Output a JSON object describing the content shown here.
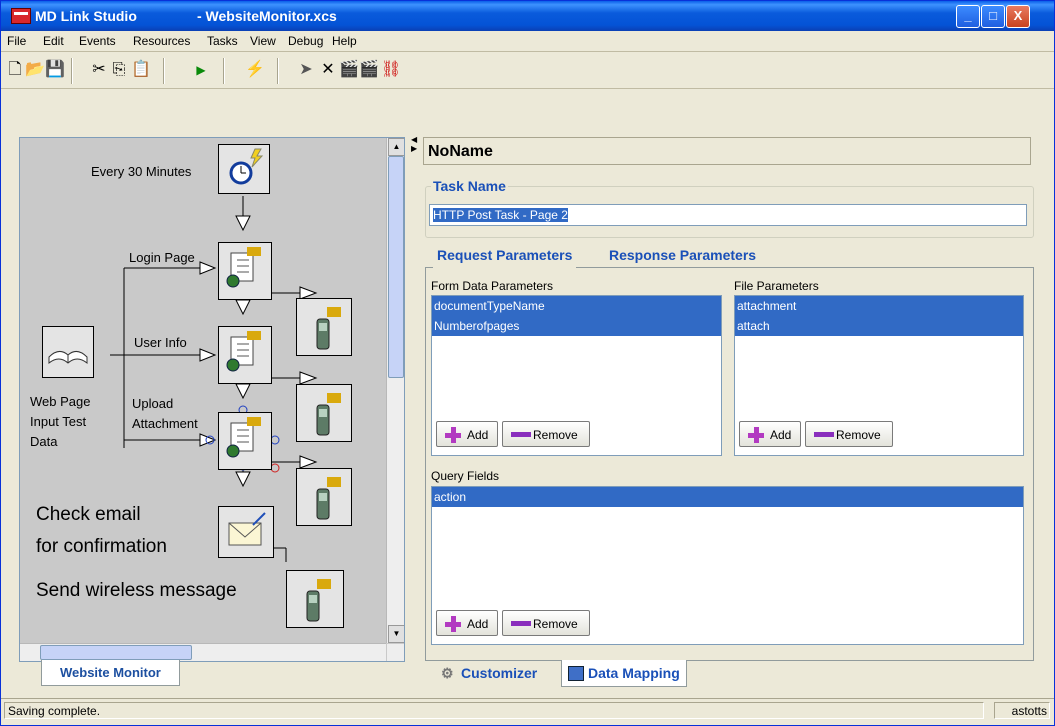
{
  "window": {
    "app_name": "MD Link Studio",
    "doc_title": "- WebsiteMonitor.xcs",
    "minimize": "_",
    "maximize": "□",
    "close": "X"
  },
  "menu": [
    "File",
    "Edit",
    "Events",
    "Resources",
    "Tasks",
    "View",
    "Debug",
    "Help"
  ],
  "toolbar": {
    "icons": [
      "new-document-icon",
      "open-folder-icon",
      "save-disk-icon",
      "cut-icon",
      "copy-icon",
      "paste-icon",
      "run-icon",
      "plug-icon",
      "pointer-icon",
      "delete-x-icon",
      "clapper-icon",
      "clapper-open-icon",
      "link-icon"
    ]
  },
  "workflow": {
    "labels": {
      "every30": "Every 30 Minutes",
      "login": "Login Page",
      "userinfo": "User Info",
      "upload1": "Upload",
      "upload2": "Attachment",
      "webpage1": "Web Page",
      "webpage2": "Input Test",
      "webpage3": "Data",
      "check1": "Check email",
      "check2": "for confirmation",
      "send": "Send wireless message"
    },
    "tab": "Website Monitor"
  },
  "task": {
    "header": "NoName",
    "group_label": "Task Name",
    "name_value": "HTTP Post Task - Page 2",
    "tabs": [
      "Request Parameters",
      "Response Parameters"
    ],
    "form_label": "Form Data Parameters",
    "form_items": [
      "documentTypeName",
      "Numberofpages"
    ],
    "file_label": "File Parameters",
    "file_items": [
      "attachment",
      "attach"
    ],
    "query_label": "Query Fields",
    "query_items": [
      "action"
    ],
    "add": "Add",
    "remove": "Remove"
  },
  "bottom_tabs": [
    "Customizer",
    "Data Mapping"
  ],
  "status": {
    "text": "Saving complete.",
    "user": "astotts"
  },
  "colors": {
    "titlebar": "#0453d6",
    "selection": "#316ac5",
    "tab_text": "#1a50b8"
  }
}
